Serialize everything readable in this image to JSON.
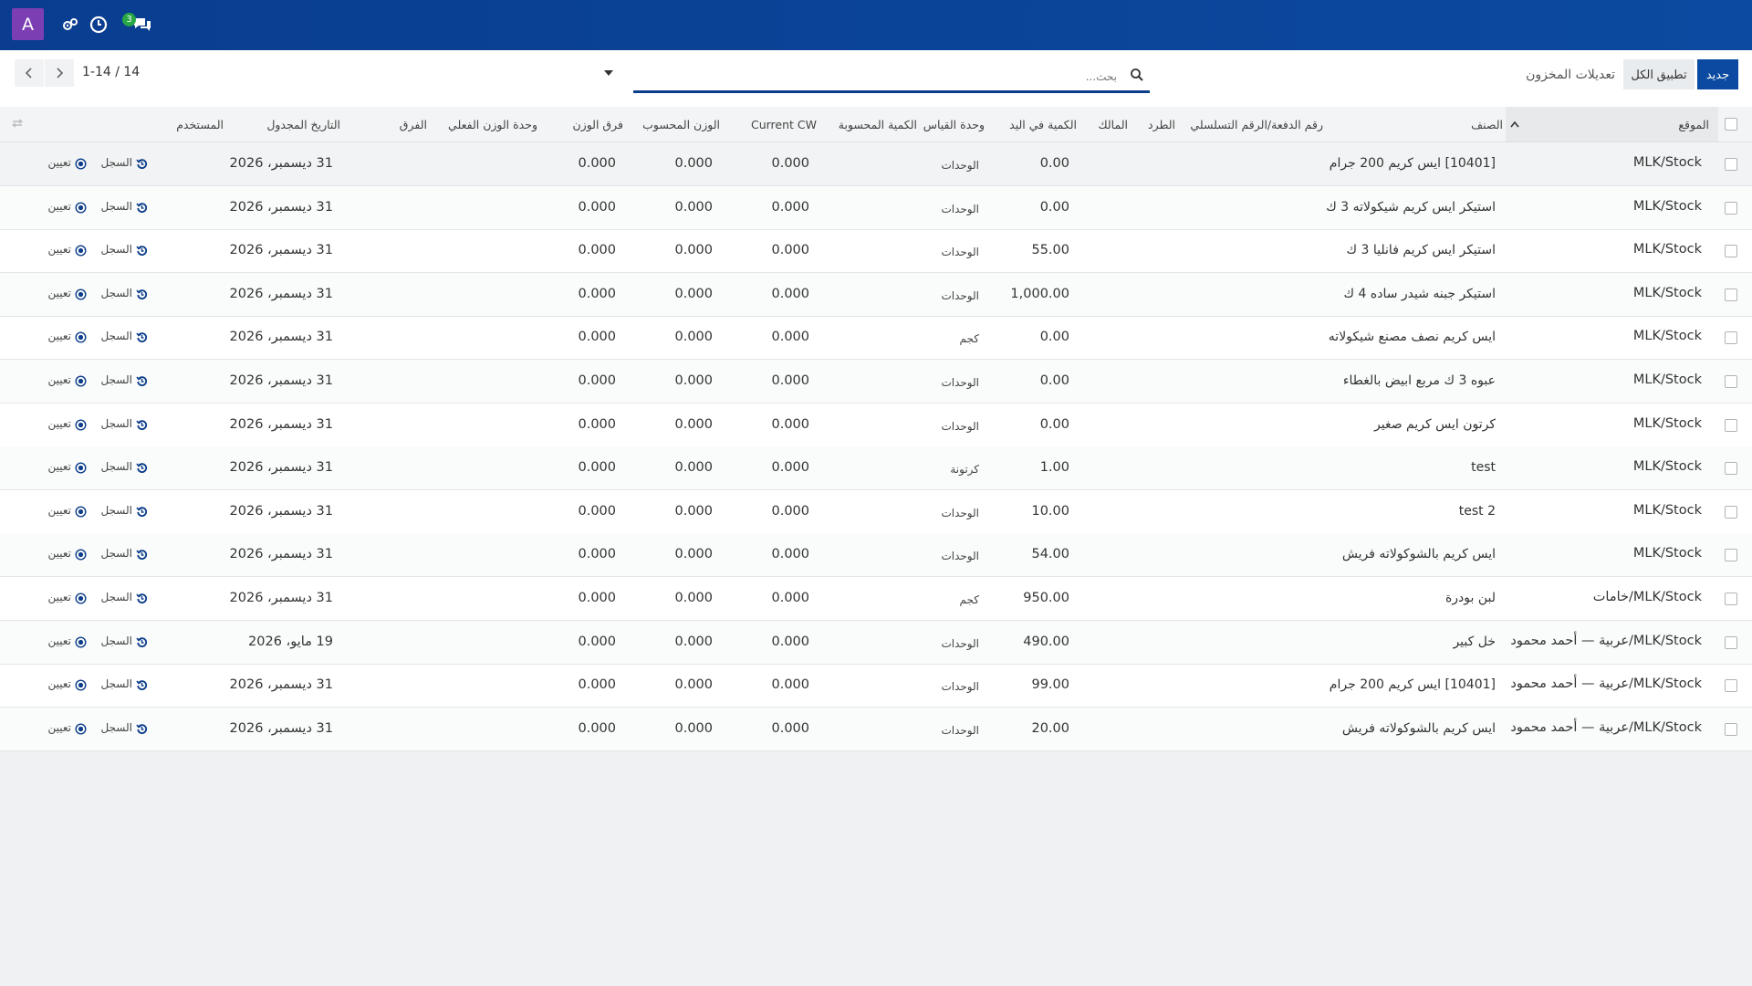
{
  "navbar": {
    "avatar_letter": "A",
    "chat_badge": "3",
    "icons": [
      "settings-gears-icon",
      "clock-icon",
      "chat-icon"
    ],
    "bg_color": "#0b4aa0",
    "avatar_color": "#7b3fb3"
  },
  "control": {
    "new_button": "جديد",
    "apply_all_button": "تطبيق الكل",
    "breadcrumb": "تعديلات المخزون",
    "search_placeholder": "بحث...",
    "pager": "1-14 / 14"
  },
  "table": {
    "headers": {
      "location": "الموقع",
      "product": "الصنف",
      "lot": "رقم الدفعة/الرقم التسلسلي",
      "package": "الطرد",
      "owner": "المالك",
      "on_hand": "الكمية في اليد",
      "uom": "وحدة القياس",
      "counted": "الكمية المحسوبة",
      "current_cw": "Current CW",
      "computed_weight": "الوزن المحسوب",
      "weight_diff": "فرق الوزن",
      "actual_weight_uom": "وحدة الوزن الفعلي",
      "difference": "الفرق",
      "scheduled_date": "التاريخ المجدول",
      "user": "المستخدم"
    },
    "action_history": "السجل",
    "action_assign": "تعيين",
    "rows": [
      {
        "location": "MLK/Stock",
        "product": "[10401] ايس كريم 200 جرام",
        "on_hand": "0.00",
        "uom": "الوحدات",
        "current_cw": "0.000",
        "computed_weight": "0.000",
        "weight_diff": "0.000",
        "date": "31 ديسمبر، 2026"
      },
      {
        "location": "MLK/Stock",
        "product": "استيكر ايس كريم شيكولاته 3 ك",
        "on_hand": "0.00",
        "uom": "الوحدات",
        "current_cw": "0.000",
        "computed_weight": "0.000",
        "weight_diff": "0.000",
        "date": "31 ديسمبر، 2026"
      },
      {
        "location": "MLK/Stock",
        "product": "استيكر ايس كريم فانليا 3 ك",
        "on_hand": "55.00",
        "uom": "الوحدات",
        "current_cw": "0.000",
        "computed_weight": "0.000",
        "weight_diff": "0.000",
        "date": "31 ديسمبر، 2026"
      },
      {
        "location": "MLK/Stock",
        "product": "استيكر جبنه شيدر ساده 4 ك",
        "on_hand": "1,000.00",
        "uom": "الوحدات",
        "current_cw": "0.000",
        "computed_weight": "0.000",
        "weight_diff": "0.000",
        "date": "31 ديسمبر، 2026"
      },
      {
        "location": "MLK/Stock",
        "product": "ايس كريم نصف مصنع شيكولاته",
        "on_hand": "0.00",
        "uom": "كجم",
        "current_cw": "0.000",
        "computed_weight": "0.000",
        "weight_diff": "0.000",
        "date": "31 ديسمبر، 2026"
      },
      {
        "location": "MLK/Stock",
        "product": "عبوه 3 ك مربع ابيض بالغطاء",
        "on_hand": "0.00",
        "uom": "الوحدات",
        "current_cw": "0.000",
        "computed_weight": "0.000",
        "weight_diff": "0.000",
        "date": "31 ديسمبر، 2026"
      },
      {
        "location": "MLK/Stock",
        "product": "كرتون ايس كريم صغير",
        "on_hand": "0.00",
        "uom": "الوحدات",
        "current_cw": "0.000",
        "computed_weight": "0.000",
        "weight_diff": "0.000",
        "date": "31 ديسمبر، 2026"
      },
      {
        "location": "MLK/Stock",
        "product": "test",
        "on_hand": "1.00",
        "uom": "كرتونة",
        "current_cw": "0.000",
        "computed_weight": "0.000",
        "weight_diff": "0.000",
        "date": "31 ديسمبر، 2026"
      },
      {
        "location": "MLK/Stock",
        "product": "test 2",
        "on_hand": "10.00",
        "uom": "الوحدات",
        "current_cw": "0.000",
        "computed_weight": "0.000",
        "weight_diff": "0.000",
        "date": "31 ديسمبر، 2026"
      },
      {
        "location": "MLK/Stock",
        "product": "ايس كريم بالشوكولاته فريش",
        "on_hand": "54.00",
        "uom": "الوحدات",
        "current_cw": "0.000",
        "computed_weight": "0.000",
        "weight_diff": "0.000",
        "date": "31 ديسمبر، 2026"
      },
      {
        "location": "MLK/Stock/خامات",
        "product": "لبن بودرة",
        "on_hand": "950.00",
        "uom": "كجم",
        "current_cw": "0.000",
        "computed_weight": "0.000",
        "weight_diff": "0.000",
        "date": "31 ديسمبر، 2026"
      },
      {
        "location": "MLK/Stock/عربية — أحمد محمود",
        "product": "خل كبير",
        "on_hand": "490.00",
        "uom": "الوحدات",
        "current_cw": "0.000",
        "computed_weight": "0.000",
        "weight_diff": "0.000",
        "date": "19 مايو، 2026"
      },
      {
        "location": "MLK/Stock/عربية — أحمد محمود",
        "product": "[10401] ايس كريم 200 جرام",
        "on_hand": "99.00",
        "uom": "الوحدات",
        "current_cw": "0.000",
        "computed_weight": "0.000",
        "weight_diff": "0.000",
        "date": "31 ديسمبر، 2026"
      },
      {
        "location": "MLK/Stock/عربية — أحمد محمود",
        "product": "ايس كريم بالشوكولاته فريش",
        "on_hand": "20.00",
        "uom": "الوحدات",
        "current_cw": "0.000",
        "computed_weight": "0.000",
        "weight_diff": "0.000",
        "date": "31 ديسمبر، 2026"
      }
    ]
  }
}
